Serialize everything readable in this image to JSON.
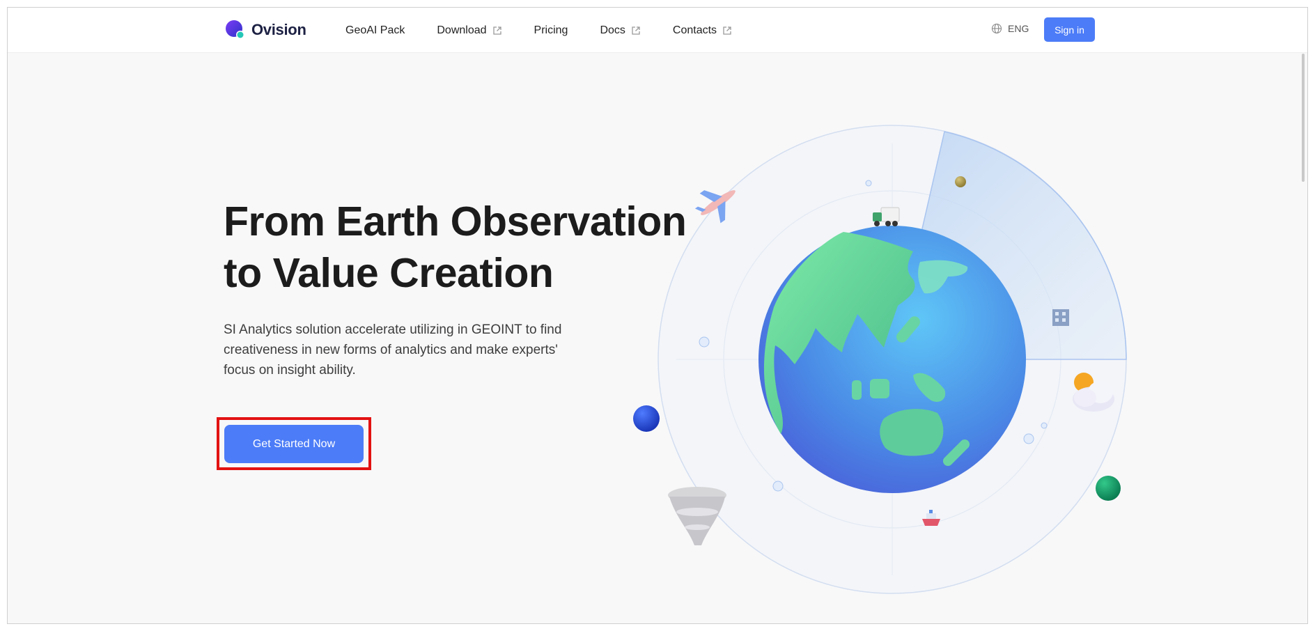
{
  "nav": {
    "brand": "Ovision",
    "items": [
      {
        "label": "GeoAI Pack",
        "external": false
      },
      {
        "label": "Download",
        "external": true
      },
      {
        "label": "Pricing",
        "external": false
      },
      {
        "label": "Docs",
        "external": true
      },
      {
        "label": "Contacts",
        "external": true
      }
    ],
    "language": "ENG",
    "sign_in": "Sign in"
  },
  "hero": {
    "title_line1": "From Earth Observation",
    "title_line2": "to Value Creation",
    "description": "SI Analytics solution accelerate utilizing in GEOINT to find creativeness in new forms of analytics and make experts' focus on insight ability.",
    "cta": "Get Started Now"
  },
  "colors": {
    "accent": "#4c7cf7",
    "highlight": "#e31212",
    "title": "#1c1c1c"
  },
  "icons": [
    "logo-icon",
    "external-link-icon",
    "globe-icon",
    "airplane-icon",
    "truck-icon",
    "building-icon",
    "weather-icon",
    "ship-icon",
    "tornado-icon",
    "earth-globe-icon"
  ]
}
